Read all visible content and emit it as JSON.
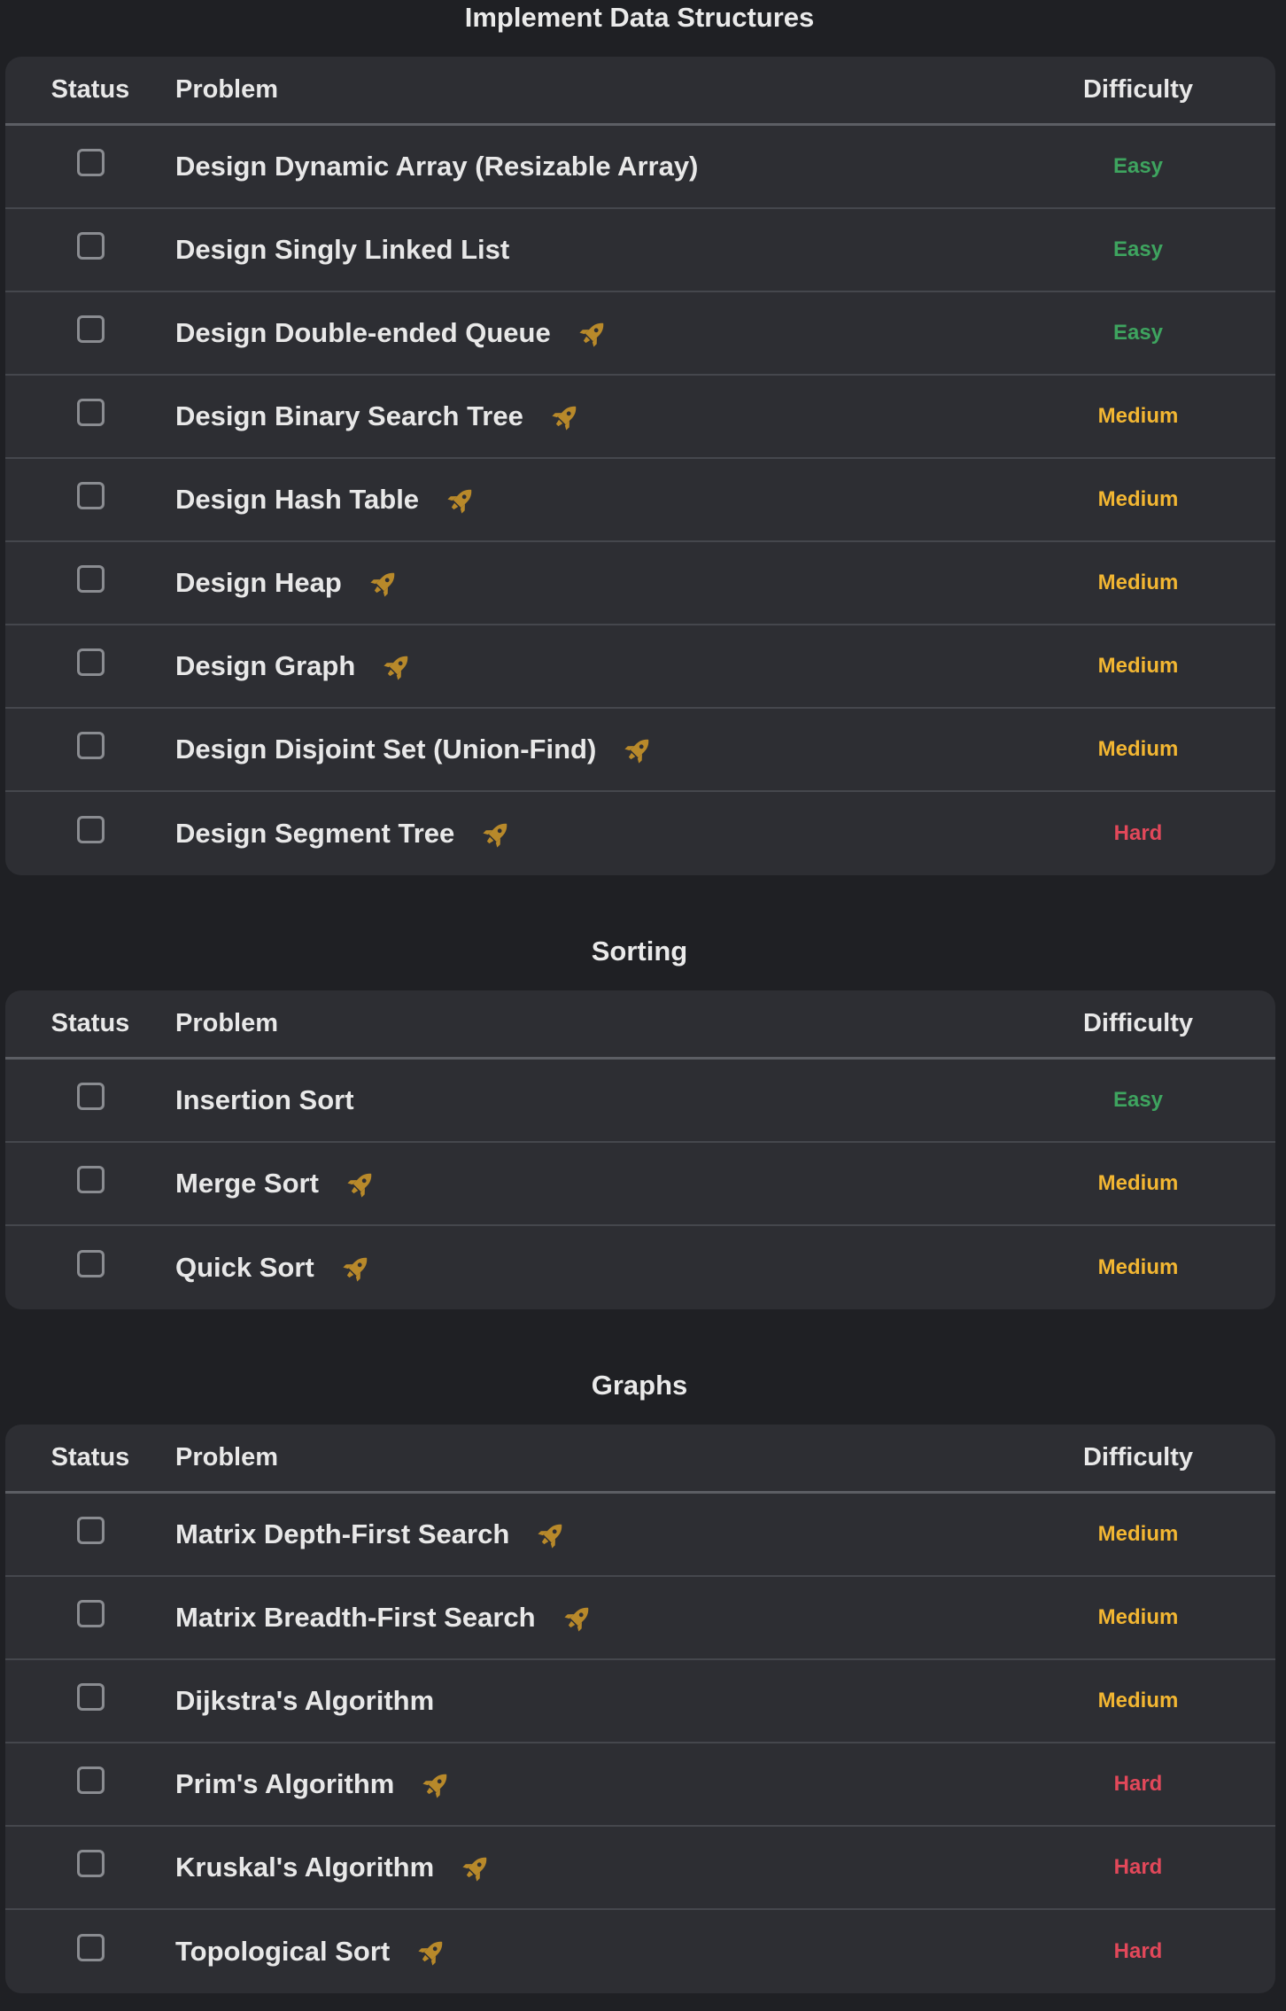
{
  "colors": {
    "background": "#1f2024",
    "panel": "#2d2e33",
    "easy": "#3ea45f",
    "medium": "#f2b632",
    "hard": "#e2485a",
    "rocket": "#b8892a"
  },
  "icons": {
    "premium": "rocket-icon",
    "status": "checkbox"
  },
  "sections": [
    {
      "title": "Implement Data Structures",
      "headers": {
        "status": "Status",
        "problem": "Problem",
        "difficulty": "Difficulty"
      },
      "rows": [
        {
          "problem": "Design Dynamic Array (Resizable Array)",
          "difficulty": "Easy",
          "premium": false
        },
        {
          "problem": "Design Singly Linked List",
          "difficulty": "Easy",
          "premium": false
        },
        {
          "problem": "Design Double-ended Queue",
          "difficulty": "Easy",
          "premium": true
        },
        {
          "problem": "Design Binary Search Tree",
          "difficulty": "Medium",
          "premium": true
        },
        {
          "problem": "Design Hash Table",
          "difficulty": "Medium",
          "premium": true
        },
        {
          "problem": "Design Heap",
          "difficulty": "Medium",
          "premium": true
        },
        {
          "problem": "Design Graph",
          "difficulty": "Medium",
          "premium": true
        },
        {
          "problem": "Design Disjoint Set (Union-Find)",
          "difficulty": "Medium",
          "premium": true
        },
        {
          "problem": "Design Segment Tree",
          "difficulty": "Hard",
          "premium": true
        }
      ]
    },
    {
      "title": "Sorting",
      "headers": {
        "status": "Status",
        "problem": "Problem",
        "difficulty": "Difficulty"
      },
      "rows": [
        {
          "problem": "Insertion Sort",
          "difficulty": "Easy",
          "premium": false
        },
        {
          "problem": "Merge Sort",
          "difficulty": "Medium",
          "premium": true
        },
        {
          "problem": "Quick Sort",
          "difficulty": "Medium",
          "premium": true
        }
      ]
    },
    {
      "title": "Graphs",
      "headers": {
        "status": "Status",
        "problem": "Problem",
        "difficulty": "Difficulty"
      },
      "rows": [
        {
          "problem": "Matrix Depth-First Search",
          "difficulty": "Medium",
          "premium": true
        },
        {
          "problem": "Matrix Breadth-First Search",
          "difficulty": "Medium",
          "premium": true
        },
        {
          "problem": "Dijkstra's Algorithm",
          "difficulty": "Medium",
          "premium": false
        },
        {
          "problem": "Prim's Algorithm",
          "difficulty": "Hard",
          "premium": true
        },
        {
          "problem": "Kruskal's Algorithm",
          "difficulty": "Hard",
          "premium": true
        },
        {
          "problem": "Topological Sort",
          "difficulty": "Hard",
          "premium": true
        }
      ]
    }
  ]
}
